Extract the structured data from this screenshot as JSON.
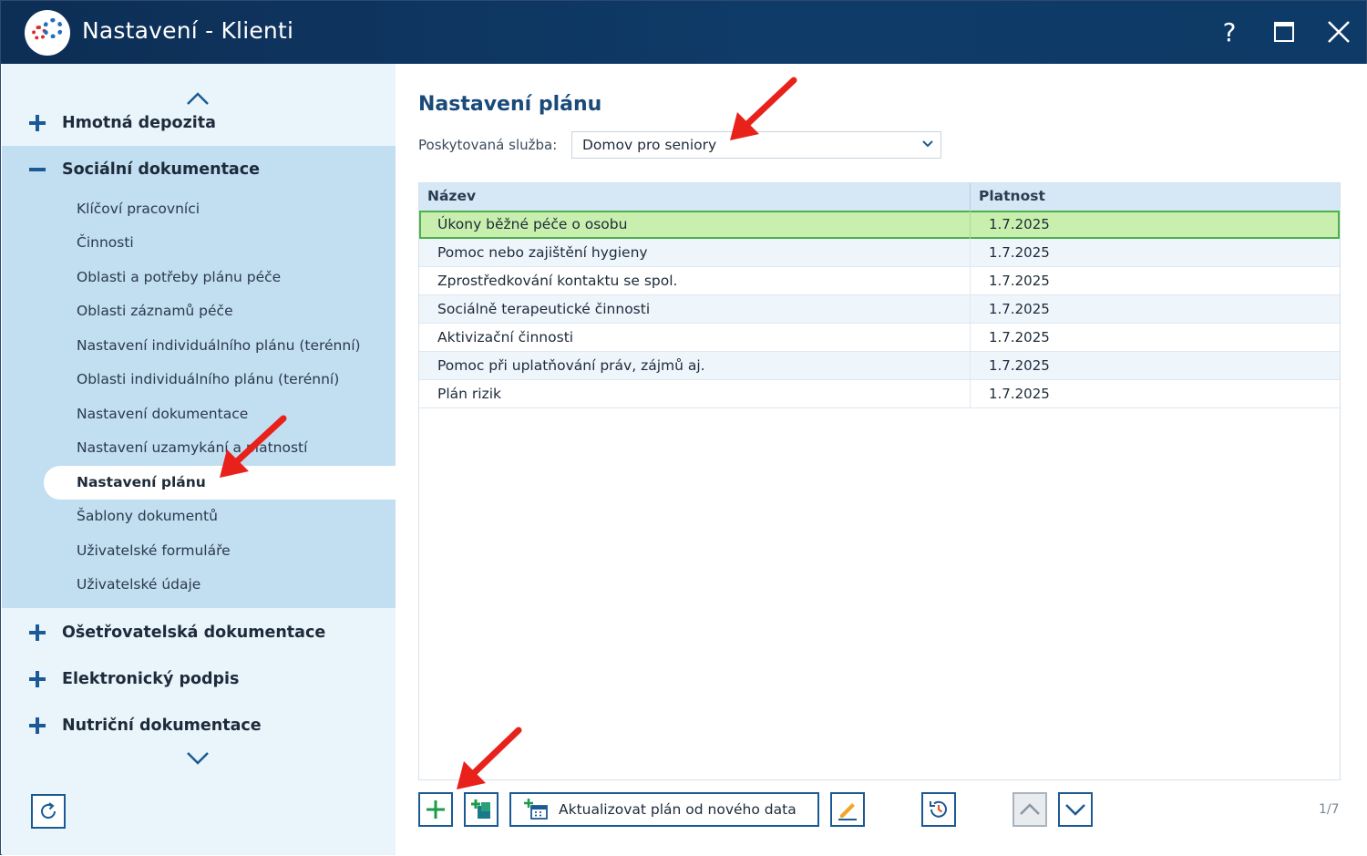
{
  "window": {
    "title": "Nastavení - Klienti",
    "help_label": "?"
  },
  "sidebar": {
    "sections": [
      {
        "label": "Hmotná depozita",
        "expanded": false
      },
      {
        "label": "Sociální dokumentace",
        "expanded": true
      },
      {
        "label": "Ošetřovatelská dokumentace",
        "expanded": false
      },
      {
        "label": "Elektronický podpis",
        "expanded": false
      },
      {
        "label": "Nutriční dokumentace",
        "expanded": false
      }
    ],
    "sub_items": [
      "Klíčoví pracovníci",
      "Činnosti",
      "Oblasti a potřeby plánu péče",
      "Oblasti záznamů péče",
      "Nastavení individuálního plánu (terénní)",
      "Oblasti individuálního plánu (terénní)",
      "Nastavení dokumentace",
      "Nastavení uzamykání a platností",
      "Nastavení plánu",
      "Šablony dokumentů",
      "Uživatelské formuláře",
      "Uživatelské údaje"
    ],
    "active_item": "Nastavení plánu"
  },
  "main": {
    "page_title": "Nastavení plánu",
    "service_label": "Poskytovaná služba:",
    "service_value": "Domov pro seniory",
    "columns": {
      "name": "Název",
      "validity": "Platnost"
    },
    "rows": [
      {
        "name": "Úkony běžné péče o osobu",
        "validity": "1.7.2025",
        "selected": true
      },
      {
        "name": "Pomoc nebo zajištění hygieny",
        "validity": "1.7.2025"
      },
      {
        "name": "Zprostředkování kontaktu se spol.",
        "validity": "1.7.2025"
      },
      {
        "name": "Sociálně terapeutické činnosti",
        "validity": "1.7.2025"
      },
      {
        "name": "Aktivizační činnosti",
        "validity": "1.7.2025"
      },
      {
        "name": "Pomoc při uplatňování práv, zájmů aj.",
        "validity": "1.7.2025"
      },
      {
        "name": "Plán rizik",
        "validity": "1.7.2025"
      }
    ],
    "toolbar": {
      "update_label": "Aktualizovat plán od nového data"
    },
    "pager": "1/7"
  },
  "colors": {
    "titlebar": "#0f3b68",
    "sidebar_bg": "#eaf4fb",
    "expanded_bg": "#c2def1",
    "accent": "#1b5a94",
    "selected_row": "#c8efad",
    "annotation_arrow": "#e8211a"
  }
}
